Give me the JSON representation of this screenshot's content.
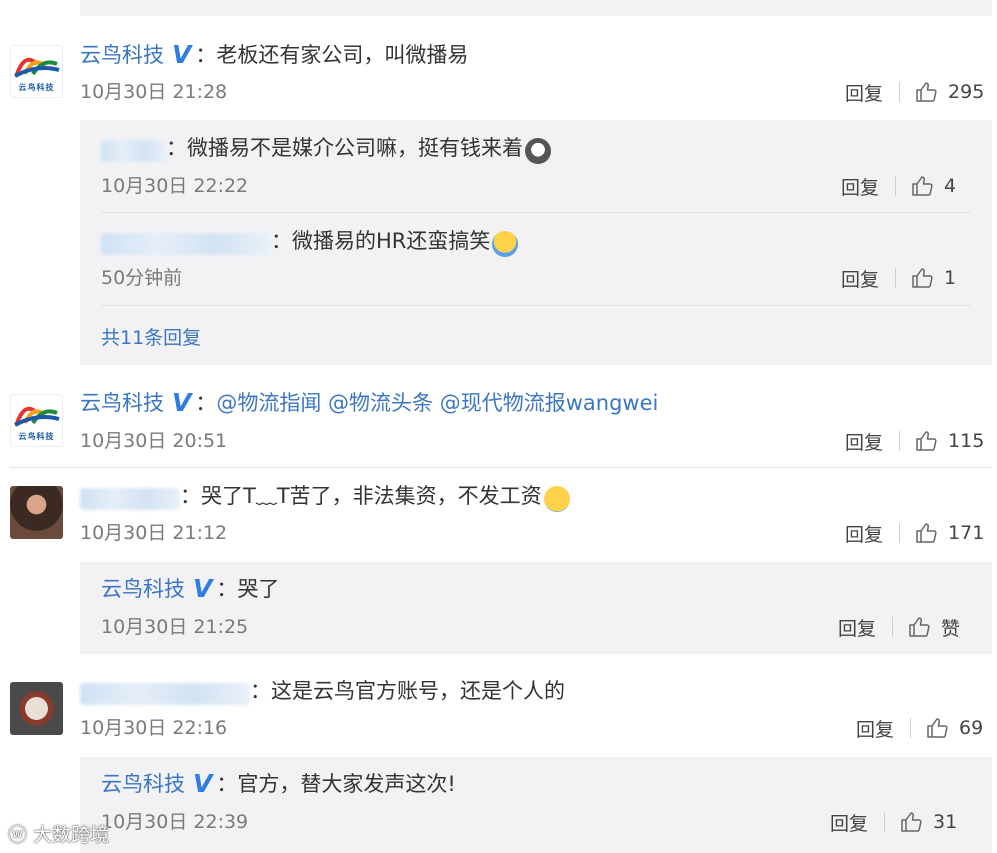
{
  "comments": [
    {
      "author": "云鸟科技",
      "author_logo_text": "云鸟科技",
      "verified": "V",
      "content": "老板还有家公司，叫微播易",
      "time": "10月30日 21:28",
      "reply_label": "回复",
      "likes": "295",
      "replies": [
        {
          "content": "微播易不是媒介公司嘛，挺有钱来着",
          "time": "10月30日 22:22",
          "reply_label": "回复",
          "likes": "4"
        },
        {
          "content": "微播易的HR还蛮搞笑",
          "time": "50分钟前",
          "reply_label": "回复",
          "likes": "1"
        }
      ],
      "more_replies": "共11条回复"
    },
    {
      "author": "云鸟科技",
      "author_logo_text": "云鸟科技",
      "verified": "V",
      "mentions": [
        "@物流指闻",
        "@物流头条",
        "@现代物流报wangwei"
      ],
      "time": "10月30日 20:51",
      "reply_label": "回复",
      "likes": "115"
    },
    {
      "content": "哭了T﹏T苦了，非法集资，不发工资",
      "time": "10月30日 21:12",
      "reply_label": "回复",
      "likes": "171",
      "replies": [
        {
          "author": "云鸟科技",
          "verified": "V",
          "content": "哭了",
          "time": "10月30日 21:25",
          "reply_label": "回复",
          "likes": "赞"
        }
      ]
    },
    {
      "content": "这是云鸟官方账号，还是个人的",
      "time": "10月30日 22:16",
      "reply_label": "回复",
      "likes": "69",
      "replies": [
        {
          "author": "云鸟科技",
          "verified": "V",
          "content": "官方，替大家发声这次!",
          "time": "10月30日 22:39",
          "reply_label": "回复",
          "likes": "31"
        }
      ]
    }
  ],
  "watermark": "大数跨境",
  "colors": {
    "link": "#3b76c2",
    "verified": "#2f7ce5",
    "reply_bg": "#f2f2f5",
    "muted": "#7a7a7a"
  }
}
